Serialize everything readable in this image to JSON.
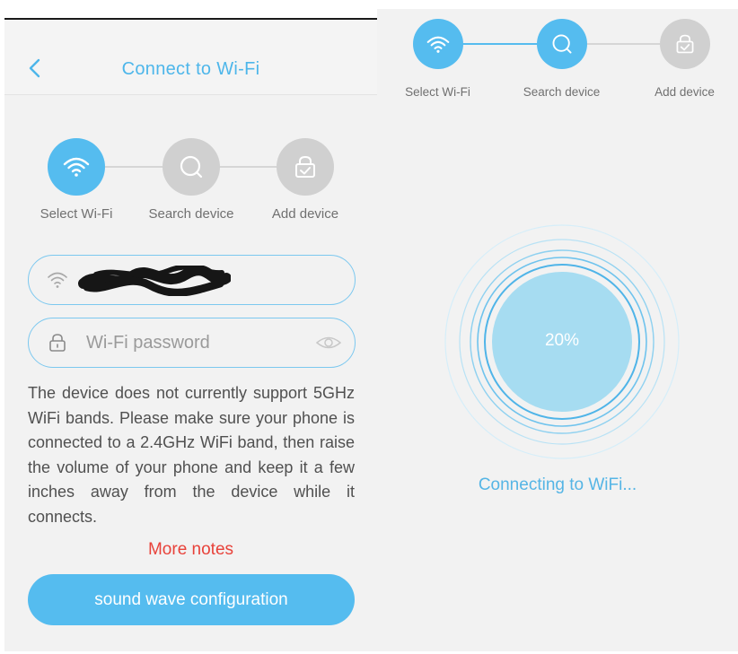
{
  "left_screen": {
    "header": {
      "title": "Connect to Wi-Fi"
    },
    "stepper": {
      "steps": [
        {
          "label": "Select Wi-Fi",
          "icon": "wifi-icon",
          "state": "active"
        },
        {
          "label": "Search device",
          "icon": "search-icon",
          "state": "inactive"
        },
        {
          "label": "Add device",
          "icon": "lock-check-icon",
          "state": "inactive"
        }
      ]
    },
    "wifi_field": {
      "value": "",
      "icon": "wifi-icon",
      "redacted": true
    },
    "password_field": {
      "placeholder": "Wi-Fi password",
      "value": "",
      "icon": "lock-icon",
      "toggle_icon": "eye-icon"
    },
    "notice": "The device does not currently support 5GHz WiFi bands. Please make sure your phone is connected to a 2.4GHz WiFi band, then raise the volume of your phone and keep it a few inches away from the device while it connects.",
    "more_notes": "More notes",
    "config_button": "sound wave configuration"
  },
  "right_screen": {
    "stepper": {
      "steps": [
        {
          "label": "Select Wi-Fi",
          "icon": "wifi-icon",
          "state": "complete"
        },
        {
          "label": "Search device",
          "icon": "search-icon",
          "state": "active"
        },
        {
          "label": "Add device",
          "icon": "lock-check-icon",
          "state": "inactive"
        }
      ]
    },
    "progress": {
      "value": 0.2,
      "label": "20%"
    },
    "status": "Connecting to WiFi..."
  },
  "colors": {
    "accent": "#55bcef",
    "inactive_step": "#d0d0d0",
    "warning_text": "#e8423a",
    "background": "#f2f2f2",
    "progress_fill": "#a6dcf1"
  }
}
